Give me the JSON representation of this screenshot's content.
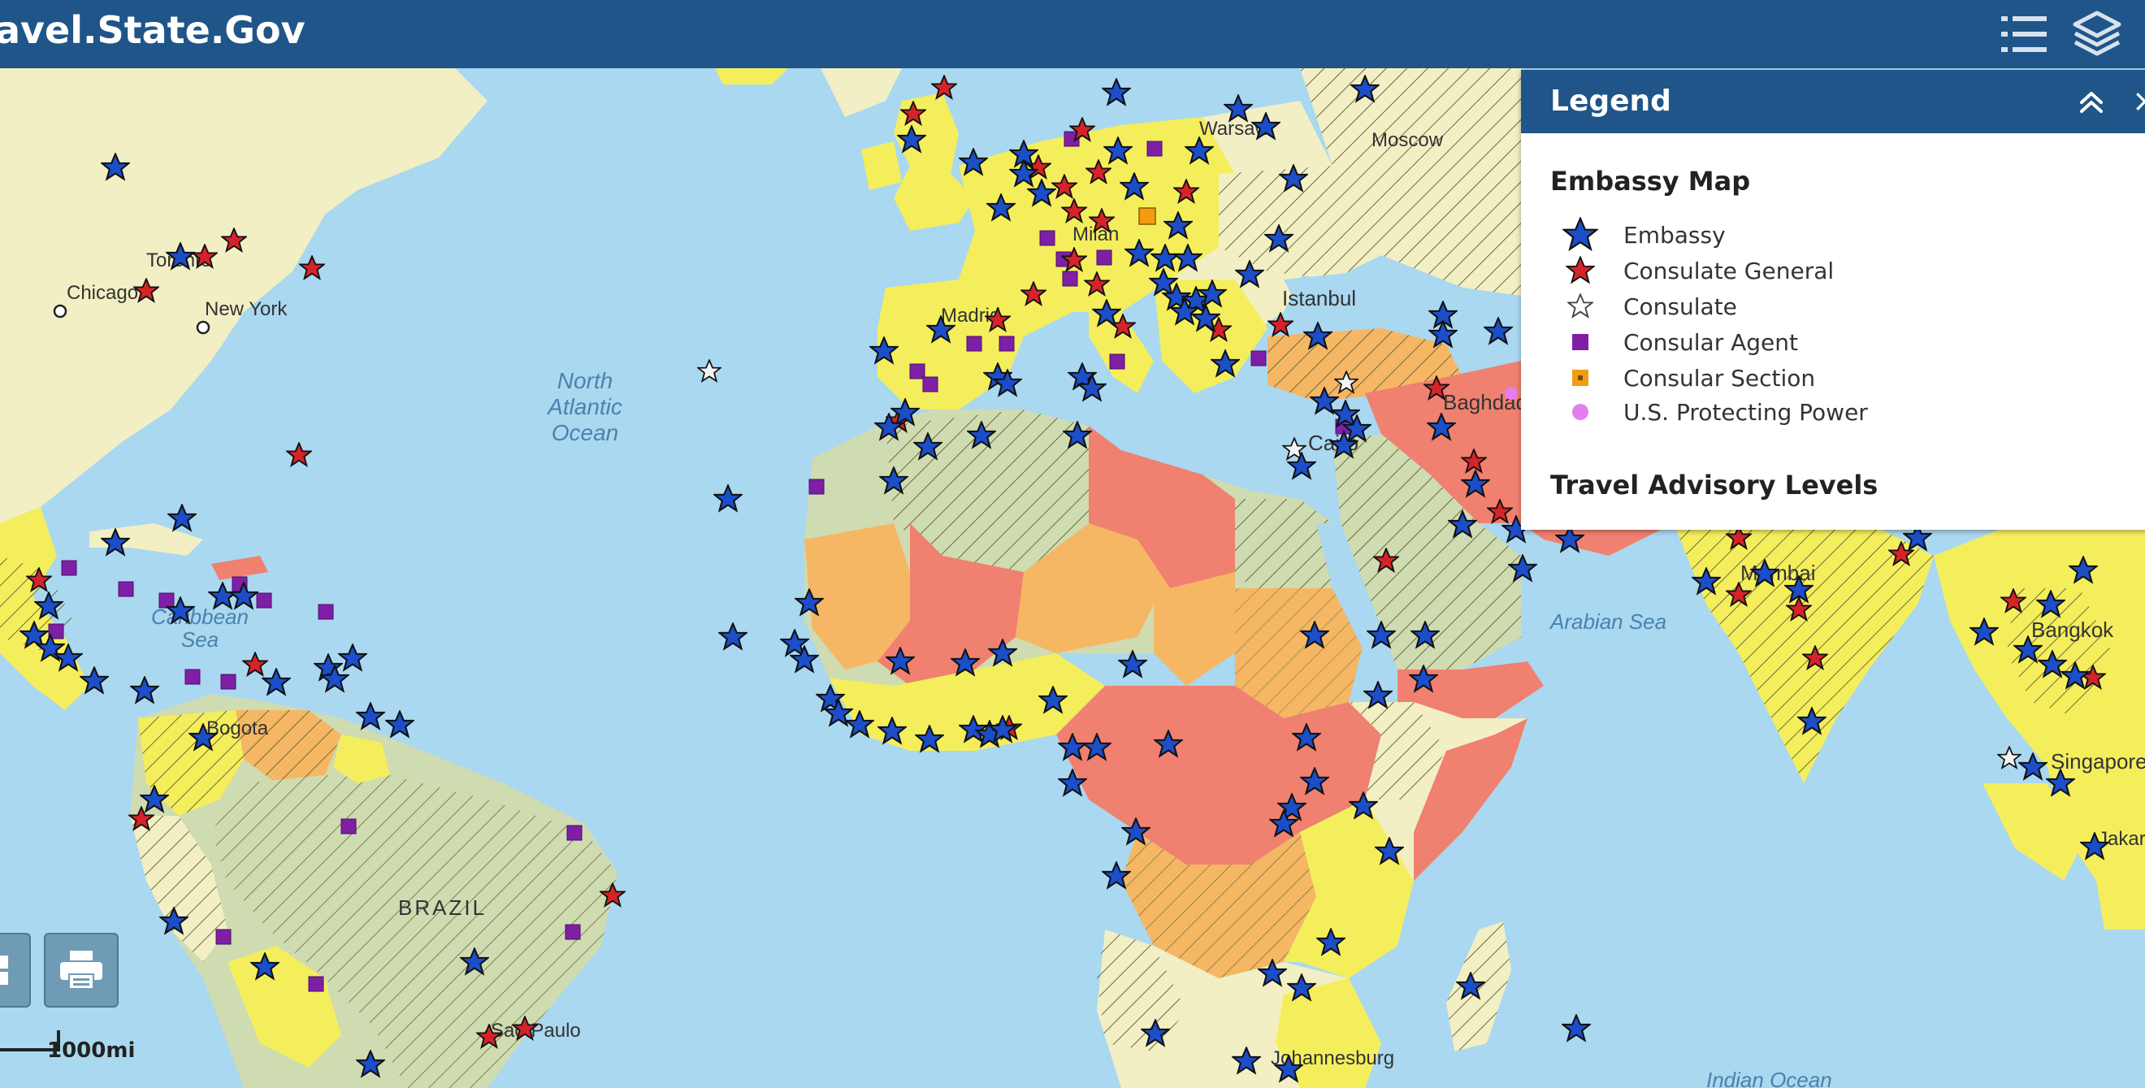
{
  "header": {
    "title": "avel.State.Gov",
    "list_button_icon": "list-icon",
    "layers_button_icon": "layers-icon"
  },
  "colors": {
    "header_bg": "#1f5589",
    "ocean": "#a9d8f0",
    "land_level1": "#f2efc4",
    "land_level2": "#f4ee5c",
    "land_level3": "#f5b764",
    "land_level4": "#f08070",
    "land_other": "#cfdbb0",
    "embassy": "#1b4ec8",
    "consulate_general": "#d6232a",
    "consular_agent": "#7e1fa6",
    "consular_section": "#f29c11",
    "protecting_power": "#e27ef0"
  },
  "map": {
    "place_labels": [
      "Moscow",
      "Warsaw",
      "Milan",
      "Istanbul",
      "Baghdad",
      "Cairo",
      "Chicago",
      "Toronto",
      "New York",
      "Madrid",
      "Mumbai",
      "Bangkok",
      "Singapore",
      "Jakarta",
      "Bogota",
      "BRAZIL",
      "Sao Paulo",
      "Johannesburg"
    ],
    "ocean_labels": {
      "north_atlantic": [
        "North",
        "Atlantic",
        "Ocean"
      ],
      "caribbean": [
        "Caribbean",
        "Sea"
      ],
      "arabian": "Arabian Sea",
      "indian": "Indian Ocean"
    },
    "scale_label": "1000mi"
  },
  "legend": {
    "title": "Legend",
    "collapse_icon": "double-chevron-up-icon",
    "close_icon": "close-icon",
    "section_title": "Embassy Map",
    "items": [
      {
        "label": "Embassy",
        "icon": "blue-star-icon"
      },
      {
        "label": "Consulate General",
        "icon": "red-star-icon"
      },
      {
        "label": "Consulate",
        "icon": "white-star-icon"
      },
      {
        "label": "Consular Agent",
        "icon": "purple-square-icon"
      },
      {
        "label": "Consular Section",
        "icon": "orange-square-icon"
      },
      {
        "label": "U.S. Protecting Power",
        "icon": "pink-circle-icon"
      }
    ],
    "advisory_title": "Travel Advisory Levels"
  },
  "controls": {
    "grid_button_icon": "grid-icon",
    "print_button_icon": "print-icon"
  }
}
